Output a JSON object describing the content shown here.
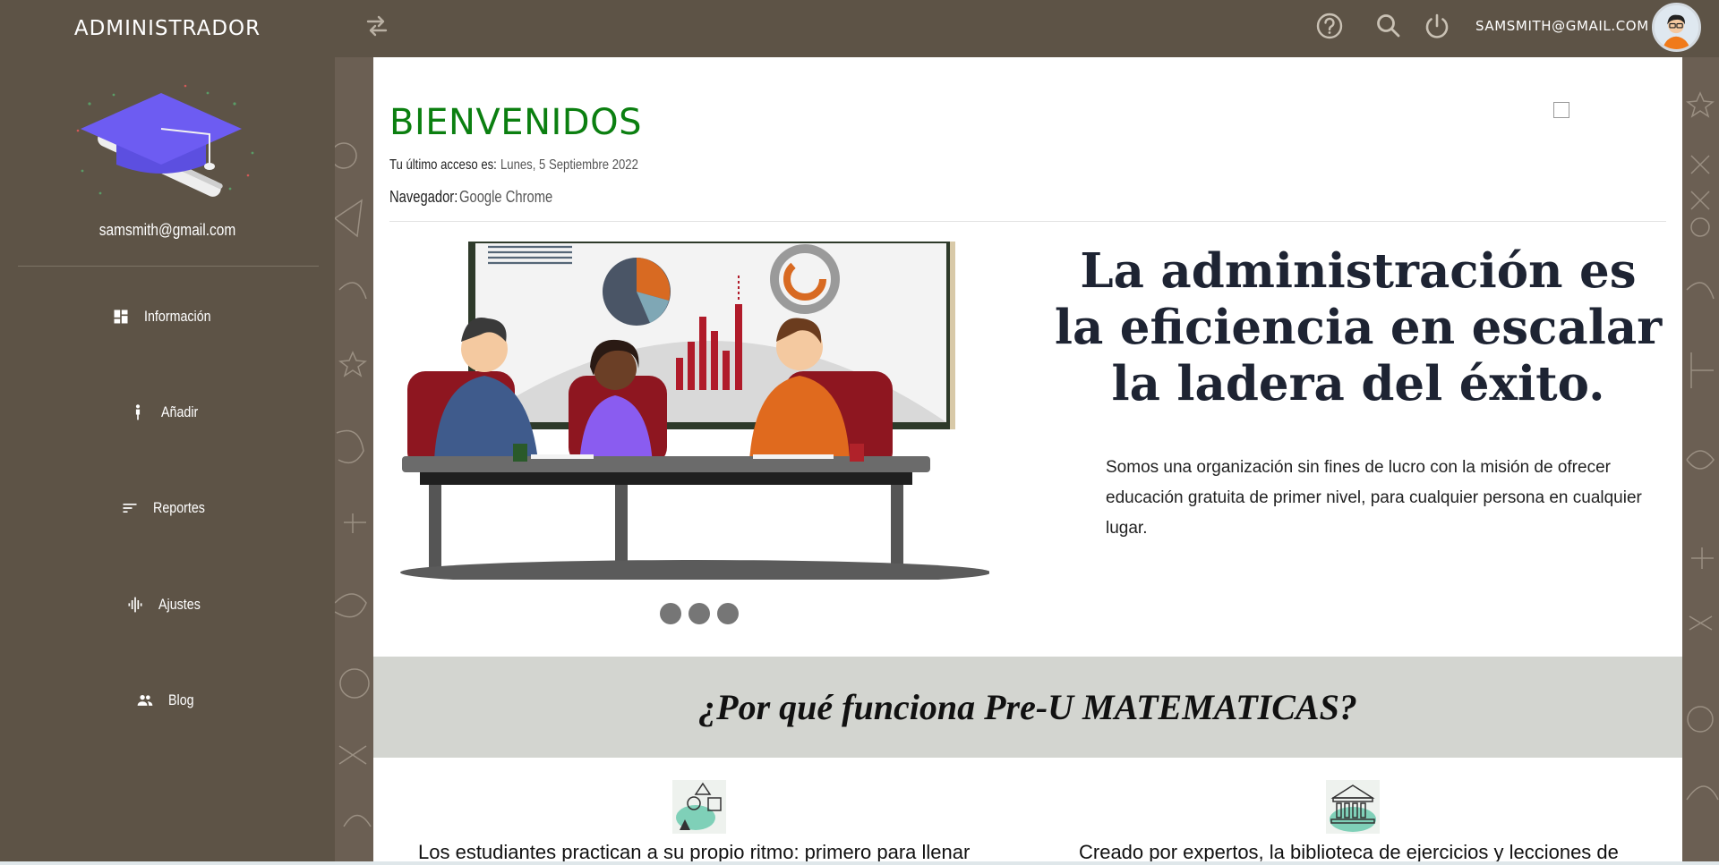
{
  "header": {
    "brand": "ADMINISTRADOR",
    "user_email": "SAMSMITH@GMAIL.COM",
    "icons": [
      "swap-icon",
      "help-icon",
      "search-icon",
      "power-icon",
      "avatar"
    ]
  },
  "sidebar": {
    "email": "samsmith@gmail.com",
    "items": [
      {
        "label": "Información",
        "icon": "dashboard-icon"
      },
      {
        "label": "Añadir",
        "icon": "person-icon"
      },
      {
        "label": "Reportes",
        "icon": "sort-icon"
      },
      {
        "label": "Ajustes",
        "icon": "equalizer-icon"
      },
      {
        "label": "Blog",
        "icon": "group-icon"
      }
    ]
  },
  "main": {
    "title": "BIENVENIDOS",
    "last_access_label": "Tu último acceso es:",
    "last_access_value": "Lunes, 5 Septiembre 2022",
    "browser_label": "Navegador:",
    "browser_value": "Google Chrome",
    "quote": "La administración es la eficiencia en escalar la ladera del éxito.",
    "mission": "Somos una organización sin fines de lucro con la misión de ofrecer educación gratuita de primer nivel, para cualquier persona en cualquier lugar.",
    "band_title": "¿Por qué funciona Pre-U MATEMATICAS?",
    "features": [
      {
        "icon": "shapes-icon",
        "text": "Los estudiantes practican a su propio ritmo: primero para llenar"
      },
      {
        "icon": "museum-icon",
        "text": "Creado por expertos, la biblioteca de ejercicios y lecciones de"
      }
    ],
    "carousel_count": 3
  },
  "colors": {
    "sidebar_bg": "#5d5346",
    "title_green": "#0b7f10",
    "band_bg": "#d3d5d0",
    "accent_purple": "#6d5cf2"
  }
}
